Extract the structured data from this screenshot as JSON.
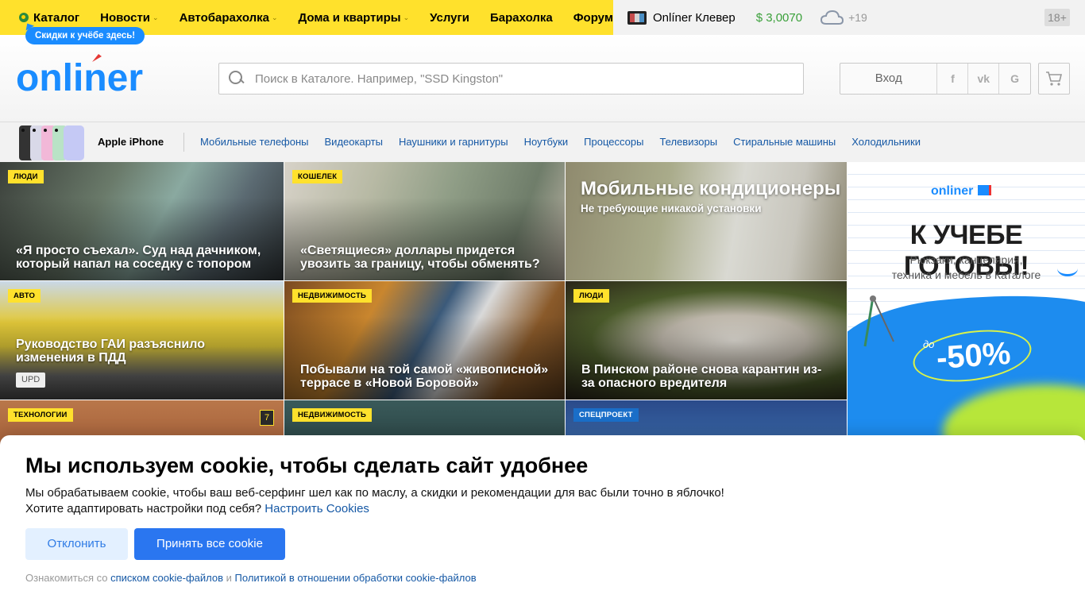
{
  "topnav": {
    "items": [
      {
        "label": "Каталог"
      },
      {
        "label": "Новости"
      },
      {
        "label": "Автобарахолка"
      },
      {
        "label": "Дома и квартиры"
      },
      {
        "label": "Услуги"
      },
      {
        "label": "Барахолка"
      },
      {
        "label": "Форум"
      }
    ],
    "promo": "Скидки к учёбе здесь!",
    "clever": "Onlíner Клевер",
    "rate": "$ 3,0070",
    "temp": "+19",
    "age": "18+"
  },
  "header": {
    "logo_text": "onliner",
    "search_placeholder": "Поиск в Каталоге. Например, \"SSD Kingston\"",
    "login": "Вход",
    "social": [
      "f",
      "vk",
      "G"
    ]
  },
  "catbar": {
    "feature": "Apple iPhone",
    "links": [
      "Мобильные телефоны",
      "Видеокарты",
      "Наушники и гарнитуры",
      "Ноутбуки",
      "Процессоры",
      "Телевизоры",
      "Стиральные машины",
      "Холодильники"
    ]
  },
  "news": [
    {
      "tag": "Люди",
      "title": "«Я просто съехал». Суд над дачником, который напал на соседку с топором"
    },
    {
      "tag": "Кошелек",
      "title": "«Светящиеся» доллары придется увозить за границу, чтобы обменять?"
    },
    {
      "title": "Мобильные кондиционеры",
      "subtitle": "Не требующие никакой установки"
    },
    {
      "tag": "Авто",
      "title": "Руководство ГАИ разъяснило изменения в ПДД",
      "badge": "UPD"
    },
    {
      "tag": "Недвижимость",
      "title": "Побывали на той самой «живописной» террасе в «Новой Боровой»"
    },
    {
      "tag": "Люди",
      "title": "В Пинском районе снова карантин из-за опасного вредителя"
    },
    {
      "tag": "Технологии",
      "comments": "7"
    },
    {
      "tag": "Недвижимость"
    },
    {
      "tag": "Спецпроект"
    }
  ],
  "ad": {
    "logo": "onliner",
    "title": "К УЧЕБЕ ГОТОВЫ!",
    "subtitle_1": "Рюкзаки, канцелярия,",
    "subtitle_2": "техника и мебель в Каталоге",
    "prefix": "до",
    "discount": "-50%"
  },
  "cookie": {
    "title": "Мы используем cookie, чтобы сделать сайт удобнее",
    "line1": "Мы обрабатываем cookie, чтобы ваш веб-серфинг шел как по маслу, а скидки и рекомендации для вас были точно в яблочко!",
    "line2": "Хотите адаптировать настройки под себя?",
    "settings_link": "Настроить Cookies",
    "decline": "Отклонить",
    "accept": "Принять все cookie",
    "foot_prefix": "Ознакомиться со",
    "foot_link1": "списком cookie-файлов",
    "foot_and": "и",
    "foot_link2": "Политикой в отношении обработки cookie-файлов"
  },
  "colors": {
    "brand_yellow": "#ffe12c",
    "brand_blue": "#1a8cff",
    "link_blue": "#1558a5",
    "accept_blue": "#2a76f0"
  }
}
